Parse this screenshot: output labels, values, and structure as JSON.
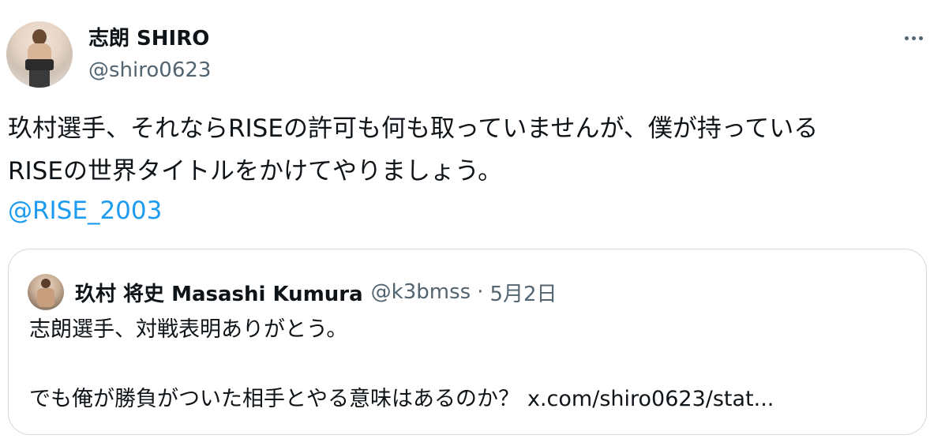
{
  "tweet": {
    "display_name": "志朗 SHIRO",
    "handle": "@shiro0623",
    "text": "玖村選手、それならRISEの許可も何も取っていませんが、僕が持っている\nRISEの世界タイトルをかけてやりましょう。",
    "mention": "@RISE_2003",
    "more_icon": "more-horizontal-icon"
  },
  "quote": {
    "display_name": "玖村 将史 Masashi Kumura",
    "handle": "@k3bmss",
    "separator": "·",
    "date": "5月2日",
    "line1": "志朗選手、対戦表明ありがとう。",
    "line2": "でも俺が勝負がついた相手とやる意味はあるのか？",
    "link": "x.com/shiro0623/stat..."
  },
  "colors": {
    "text": "#0f1419",
    "secondary": "#536471",
    "link": "#1d9bf0",
    "border": "#cfd9de"
  }
}
